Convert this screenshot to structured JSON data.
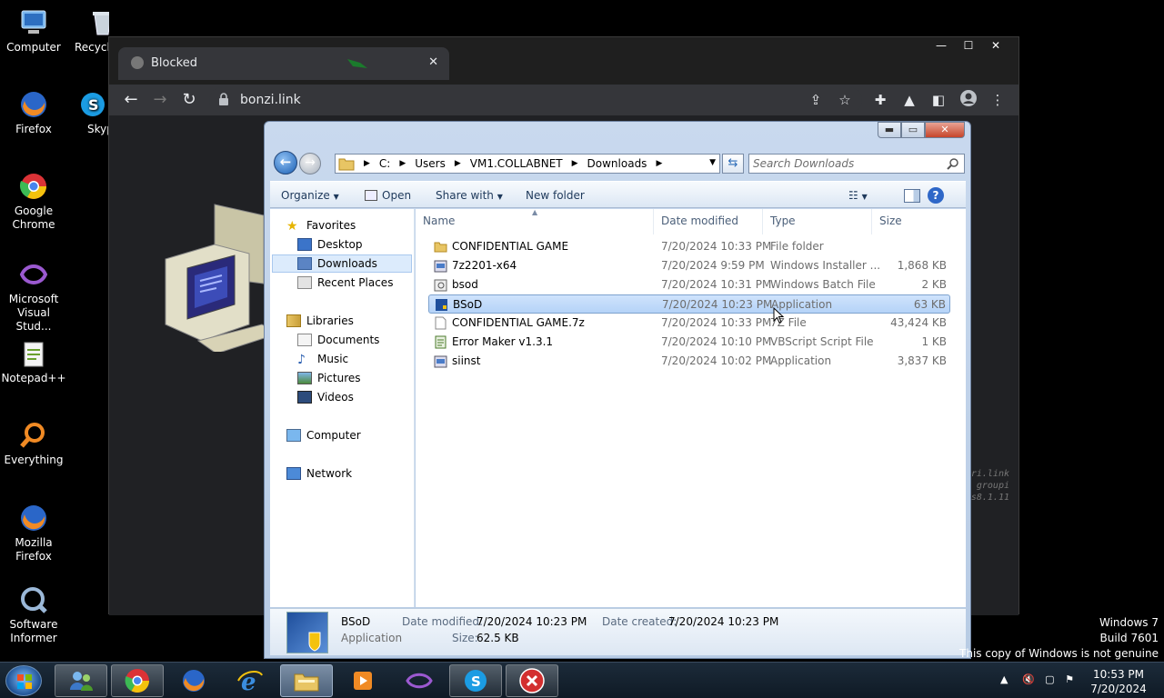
{
  "desktop_icons": [
    {
      "label": "Computer"
    },
    {
      "label": "Recycle"
    },
    {
      "label": "Firefox"
    },
    {
      "label": "Skyp"
    },
    {
      "label": "Google Chrome"
    },
    {
      "label": "Microsoft Visual Stud..."
    },
    {
      "label": "Notepad++"
    },
    {
      "label": "Everything"
    },
    {
      "label": "Mozilla Firefox"
    },
    {
      "label": "Software Informer"
    }
  ],
  "browser": {
    "tab_title": "Blocked",
    "url": "bonzi.link",
    "tab_close": "✕",
    "window_buttons": {
      "minimize": "—",
      "maximize": "☐",
      "close": "✕"
    }
  },
  "background_terminal_text": [
    "ri.link",
    "groupi",
    "s8.1.11"
  ],
  "explorer": {
    "breadcrumb": [
      "C:",
      "Users",
      "VM1.COLLABNET",
      "Downloads"
    ],
    "search_placeholder": "Search Downloads",
    "toolbar": {
      "organize": "Organize",
      "open": "Open",
      "share_with": "Share with",
      "new_folder": "New folder"
    },
    "nav": {
      "favorites": "Favorites",
      "desktop": "Desktop",
      "downloads": "Downloads",
      "recent_places": "Recent Places",
      "libraries": "Libraries",
      "documents": "Documents",
      "music": "Music",
      "pictures": "Pictures",
      "videos": "Videos",
      "computer": "Computer",
      "network": "Network"
    },
    "columns": {
      "name": "Name",
      "date": "Date modified",
      "type": "Type",
      "size": "Size"
    },
    "files": [
      {
        "name": "CONFIDENTIAL GAME",
        "date": "7/20/2024 10:33 PM",
        "type": "File folder",
        "size": ""
      },
      {
        "name": "7z2201-x64",
        "date": "7/20/2024 9:59 PM",
        "type": "Windows Installer ...",
        "size": "1,868 KB"
      },
      {
        "name": "bsod",
        "date": "7/20/2024 10:31 PM",
        "type": "Windows Batch File",
        "size": "2 KB"
      },
      {
        "name": "BSoD",
        "date": "7/20/2024 10:23 PM",
        "type": "Application",
        "size": "63 KB"
      },
      {
        "name": "CONFIDENTIAL GAME.7z",
        "date": "7/20/2024 10:33 PM",
        "type": "7Z File",
        "size": "43,424 KB"
      },
      {
        "name": "Error Maker v1.3.1",
        "date": "7/20/2024 10:10 PM",
        "type": "VBScript Script File",
        "size": "1 KB"
      },
      {
        "name": "siinst",
        "date": "7/20/2024 10:02 PM",
        "type": "Application",
        "size": "3,837 KB"
      }
    ],
    "details": {
      "name": "BSoD",
      "type": "Application",
      "date_modified_label": "Date modified:",
      "date_modified": "7/20/2024 10:23 PM",
      "date_created_label": "Date created:",
      "date_created": "7/20/2024 10:23 PM",
      "size_label": "Size:",
      "size": "62.5 KB"
    }
  },
  "watermark": {
    "line1": "Windows 7",
    "line2": "Build 7601",
    "line3": "This copy of Windows is not genuine"
  },
  "taskbar": {
    "time": "10:53 PM",
    "date": "7/20/2024"
  }
}
